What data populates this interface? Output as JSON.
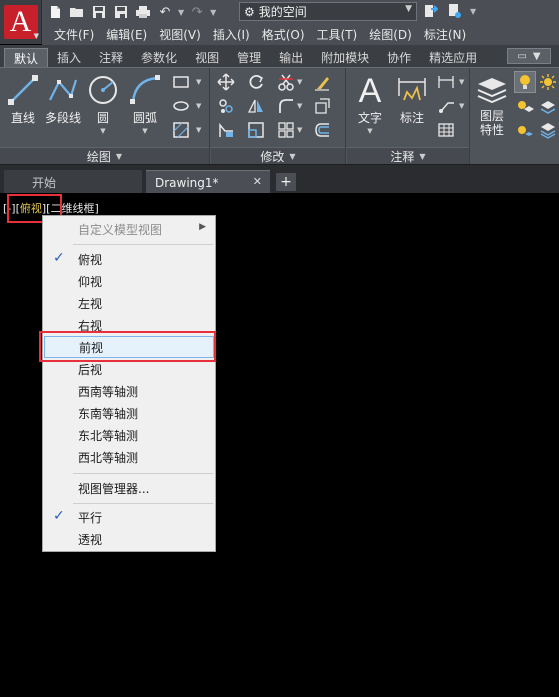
{
  "app": {
    "logo_letter": "A"
  },
  "quick_access": {
    "icons": [
      "new-icon",
      "open-icon",
      "save-icon",
      "save-as-icon",
      "print-icon",
      "undo-icon",
      "redo-icon",
      "share-icon"
    ],
    "workspace": "我的空间"
  },
  "menubar": {
    "items": [
      "文件(F)",
      "编辑(E)",
      "视图(V)",
      "插入(I)",
      "格式(O)",
      "工具(T)",
      "绘图(D)",
      "标注(N)"
    ]
  },
  "ribbon_tabs": {
    "items": [
      "默认",
      "插入",
      "注释",
      "参数化",
      "视图",
      "管理",
      "输出",
      "附加模块",
      "协作",
      "精选应用"
    ],
    "active": "默认"
  },
  "draw_panel": {
    "title": "绘图",
    "line": "直线",
    "polyline": "多段线",
    "circle": "圆",
    "arc": "圆弧"
  },
  "modify_panel": {
    "title": "修改"
  },
  "annotation_panel": {
    "title": "注释",
    "text": "文字",
    "dimension": "标注"
  },
  "layers_panel": {
    "line1": "图层",
    "line2": "特性"
  },
  "doc_tabs": {
    "start": "开始",
    "drawing": "Drawing1*",
    "close": "✕",
    "add": "+"
  },
  "viewport_label": {
    "open": "[",
    "minus": "-",
    "close": "]",
    "view": "俯视",
    "visual_style": "二维线框"
  },
  "context_menu": {
    "custom_views": "自定义模型视图",
    "views": [
      "俯视",
      "仰视",
      "左视",
      "右视",
      "前视",
      "后视",
      "西南等轴测",
      "东南等轴测",
      "东北等轴测",
      "西北等轴测"
    ],
    "view_manager": "视图管理器...",
    "parallel": "平行",
    "perspective": "透视",
    "checked_view": "俯视",
    "checked_projection": "平行",
    "highlighted": "前视"
  },
  "colors": {
    "accent_red": "#e8303a",
    "viewport_highlight": "#e6c84a",
    "check_blue": "#2b5fb5"
  }
}
